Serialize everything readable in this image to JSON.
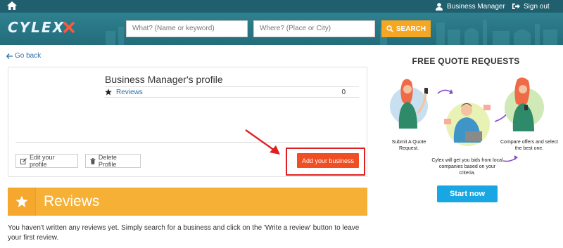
{
  "header": {
    "account_label": "Business Manager",
    "signout_label": "Sign out",
    "logo_text": "CYLEX"
  },
  "search": {
    "what_placeholder": "What? (Name or keyword)",
    "where_placeholder": "Where? (Place or City)",
    "button_label": "SEARCH"
  },
  "nav": {
    "go_back_label": "Go back"
  },
  "profile": {
    "title": "Business Manager's profile",
    "reviews_label": "Reviews",
    "reviews_count": "0",
    "edit_label": "Edit your profile",
    "delete_label": "Delete Profile",
    "add_business_label": "Add your business"
  },
  "reviews_section": {
    "title": "Reviews",
    "empty_message": "You haven't written any reviews yet. Simply search for a business and click on the 'Write a review' button to leave your first review."
  },
  "quote_panel": {
    "title": "FREE QUOTE REQUESTS",
    "step1": "Submit A Quote Request.",
    "step2": "Cylex will get you bids from local companies based on your criteria.",
    "step3": "Compare offers and select the best one.",
    "start_label": "Start now"
  },
  "colors": {
    "header": "#236c7b",
    "search_button": "#f5a623",
    "add_button": "#f04e23",
    "highlight": "#e02020",
    "banner": "#f6b035",
    "start_button": "#19a7e4"
  }
}
